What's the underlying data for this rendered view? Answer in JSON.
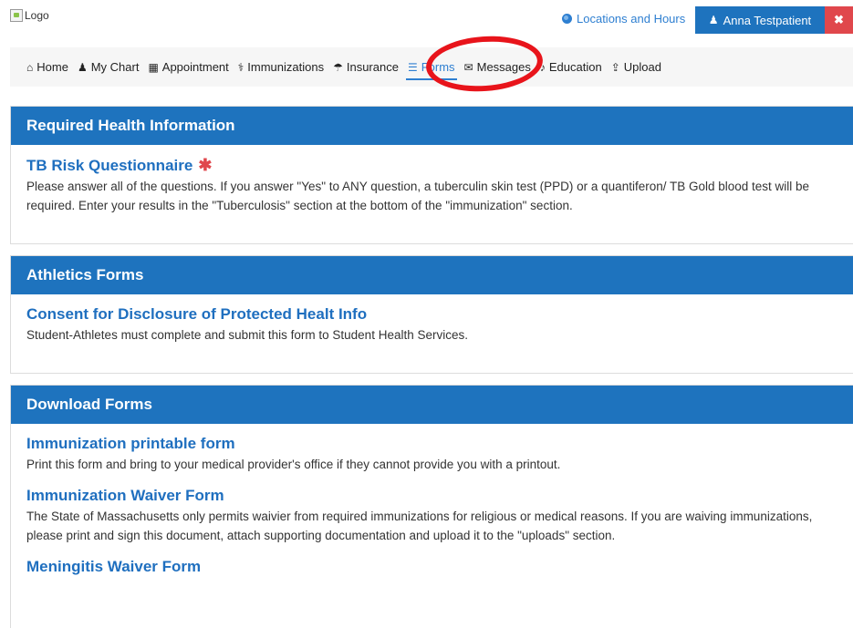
{
  "header": {
    "logo_alt": "Logo",
    "locations_label": "Locations and Hours",
    "user_name": "Anna Testpatient",
    "close_glyph": "✖"
  },
  "nav": {
    "items": [
      {
        "label": "Home",
        "icon": "home-icon",
        "glyph": "⌂"
      },
      {
        "label": "My Chart",
        "icon": "user-icon",
        "glyph": "♟"
      },
      {
        "label": "Appointment",
        "icon": "calendar-icon",
        "glyph": "▦"
      },
      {
        "label": "Immunizations",
        "icon": "stethoscope-icon",
        "glyph": "⚕"
      },
      {
        "label": "Insurance",
        "icon": "umbrella-icon",
        "glyph": "☂"
      },
      {
        "label": "Forms",
        "icon": "list-icon",
        "glyph": "☰"
      },
      {
        "label": "Messages",
        "icon": "envelope-icon",
        "glyph": "✉"
      },
      {
        "label": "Education",
        "icon": "bell-icon",
        "glyph": "♪"
      },
      {
        "label": "Upload",
        "icon": "upload-icon",
        "glyph": "⇪"
      }
    ],
    "active": "Forms"
  },
  "sections": {
    "required": {
      "title": "Required Health Information",
      "items": [
        {
          "title": "TB Risk Questionnaire",
          "required": "✱",
          "desc": "Please answer all of the questions. If you answer \"Yes\" to ANY question, a tuberculin skin test (PPD) or a quantiferon/ TB Gold blood test will be required. Enter your results in the \"Tuberculosis\" section at the bottom of the \"immunization\" section."
        }
      ]
    },
    "athletics": {
      "title": "Athletics Forms",
      "items": [
        {
          "title": "Consent for Disclosure of Protected Healt Info",
          "desc": "Student-Athletes must complete and submit this form to Student Health Services."
        }
      ]
    },
    "download": {
      "title": "Download Forms",
      "items": [
        {
          "title": "Immunization printable form",
          "desc": "Print this form and bring to your medical provider's office if they cannot provide you with a printout."
        },
        {
          "title": "Immunization Waiver Form",
          "desc": "The State of Massachusetts only permits waivier from required immunizations for religious or medical reasons. If you are waiving immunizations, please print and sign this document, attach supporting documentation and upload it to the \"uploads\" section."
        },
        {
          "title": "Meningitis Waiver Form",
          "desc": ""
        }
      ]
    }
  },
  "colors": {
    "primary": "#1e73be",
    "link": "#1f6fbf",
    "danger": "#e0474c",
    "annotation": "#e8141b"
  }
}
